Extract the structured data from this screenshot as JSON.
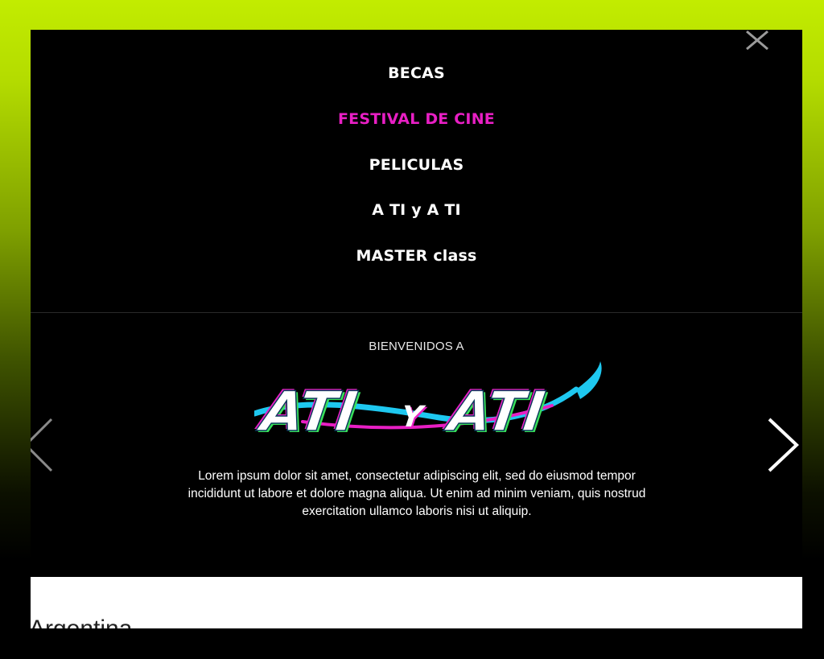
{
  "menu": {
    "items": [
      {
        "label": "BECAS"
      },
      {
        "label": "FESTIVAL DE CINE",
        "active": true
      },
      {
        "label": "PELICULAS"
      },
      {
        "label": "A TI y A TI"
      },
      {
        "label": "MASTER class"
      }
    ],
    "close_icon": "close-icon"
  },
  "hero": {
    "welcome": "BIENVENIDOS A",
    "logo_text": "ATI Y ATI",
    "description": "Lorem ipsum dolor sit amet, consectetur adipiscing elit, sed do eiusmod tempor incididunt ut labore et dolore magna aliqua.  Ut enim ad minim veniam, quis nostrud exercitation ullamco laboris nisi ut aliquip.",
    "prev_icon": "chevron-left-icon",
    "next_icon": "chevron-right-icon"
  },
  "footer_panel": {
    "country": "Argentina"
  },
  "colors": {
    "active_menu": "#e81fc4",
    "accent_cyan": "#1ec8f0",
    "accent_green": "#39e05a",
    "background_lime": "#c2ec00"
  }
}
